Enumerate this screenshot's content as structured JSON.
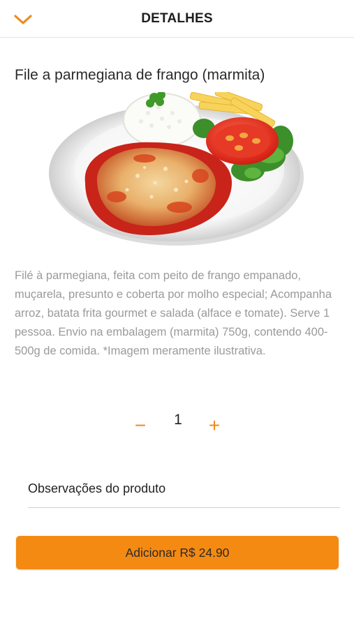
{
  "header": {
    "title": "DETALHES",
    "back_icon": "chevron-down-icon"
  },
  "product": {
    "name": "File a parmegiana de frango (marmita)",
    "description": "Filé à parmegiana, feita com peito de frango empanado, muçarela, presunto e coberta por molho especial; Acompanha arroz, batata frita gourmet e salada (alface e tomate). Serve 1 pessoa. Envio na embalagem (marmita) 750g, contendo 400-500g de comida. *Imagem meramente ilustrativa."
  },
  "quantity": {
    "minus_label": "−",
    "value": "1",
    "plus_label": "+"
  },
  "observations": {
    "placeholder": "Observações do produto"
  },
  "add_button": {
    "label": "Adicionar R$ 24.90"
  },
  "colors": {
    "accent": "#f58a12",
    "accent_icon": "#f0891a",
    "description_text": "#9a9a9a"
  }
}
